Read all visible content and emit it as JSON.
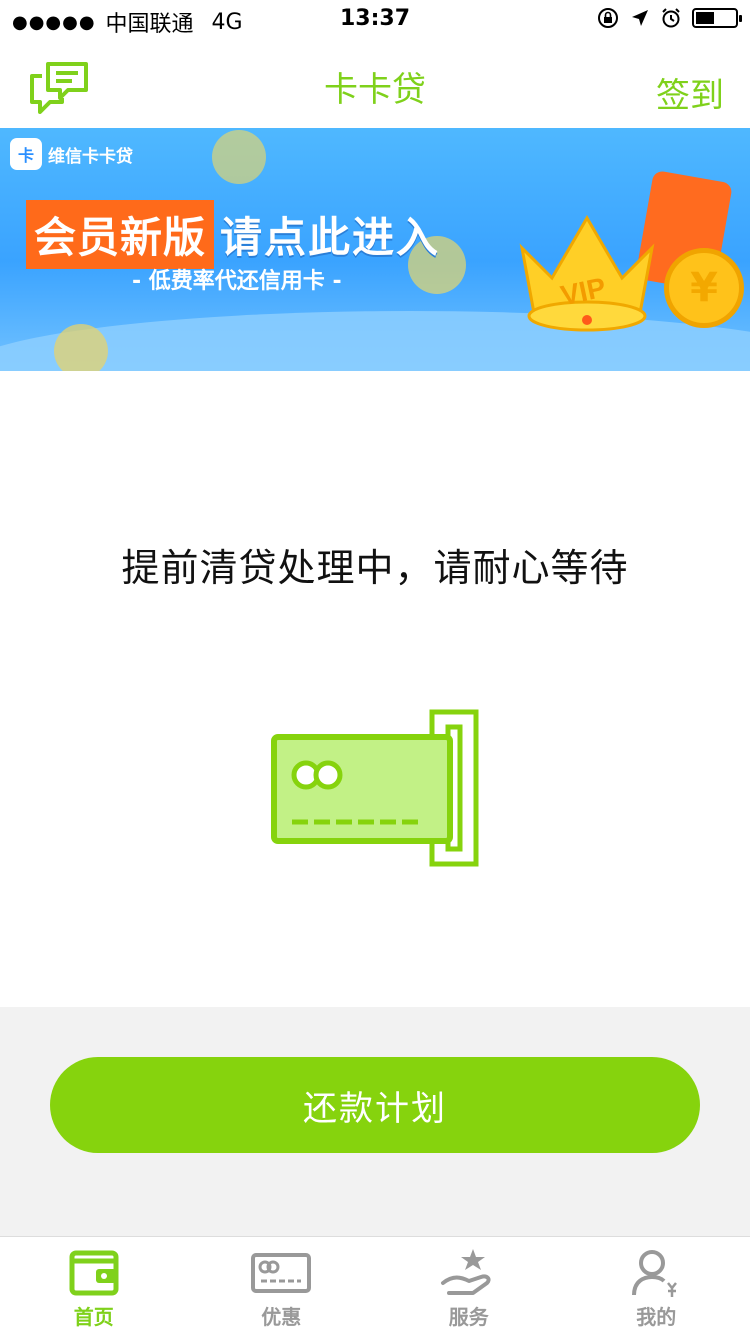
{
  "status_bar": {
    "signal_dots": "●●●●●",
    "carrier": "中国联通",
    "network": "4G",
    "time": "13:37"
  },
  "navbar": {
    "title": "卡卡贷",
    "checkin_label": "签到",
    "chat_icon": "chat-bubbles-icon"
  },
  "banner": {
    "brand_logo_text": "卡",
    "brand_name": "维信卡卡贷",
    "headline_highlight": "会员新版",
    "headline_rest": "请点此进入",
    "subline": "- 低费率代还信用卡 -",
    "vip_text": "VIP",
    "coin_symbol": "¥"
  },
  "main": {
    "status_message": "提前清贷处理中，请耐心等待"
  },
  "actions": {
    "repay_plan_label": "还款计划"
  },
  "tabbar": {
    "items": [
      {
        "label": "首页",
        "icon": "wallet-icon",
        "active": true
      },
      {
        "label": "优惠",
        "icon": "coupon-card-icon",
        "active": false
      },
      {
        "label": "服务",
        "icon": "hand-star-icon",
        "active": false
      },
      {
        "label": "我的",
        "icon": "user-yen-icon",
        "active": false
      }
    ]
  },
  "colors": {
    "accent": "#7fd11b",
    "button": "#86d30d",
    "banner_blue": "#3aa3ff",
    "banner_orange": "#ff6a1a",
    "inactive": "#999999"
  }
}
